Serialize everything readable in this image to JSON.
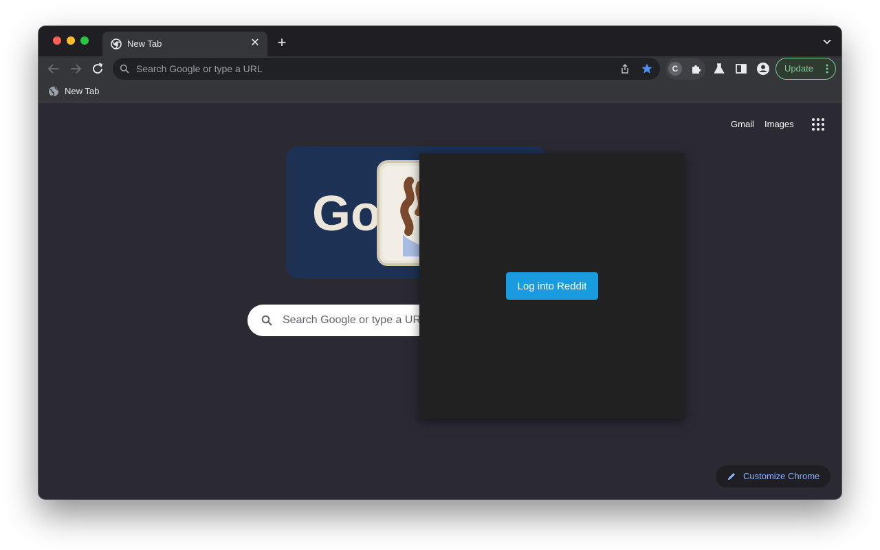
{
  "browser": {
    "tab": {
      "title": "New Tab"
    },
    "omnibox": {
      "placeholder": "Search Google or type a URL"
    },
    "extension_letter": "C",
    "update_label": "Update",
    "bookmarks": [
      {
        "label": "New Tab"
      }
    ]
  },
  "page": {
    "top_links": {
      "gmail": "Gmail",
      "images": "Images"
    },
    "doodle_text": "Go",
    "search_placeholder": "Search Google or type a URL",
    "customize_label": "Customize Chrome"
  },
  "popup": {
    "button_label": "Log into Reddit"
  },
  "colors": {
    "popup_bg": "#212121",
    "reddit_button": "#1a9bdf",
    "update_accent": "#81c995",
    "link_accent": "#8ab4f8",
    "star_accent": "#4d8ff5"
  }
}
